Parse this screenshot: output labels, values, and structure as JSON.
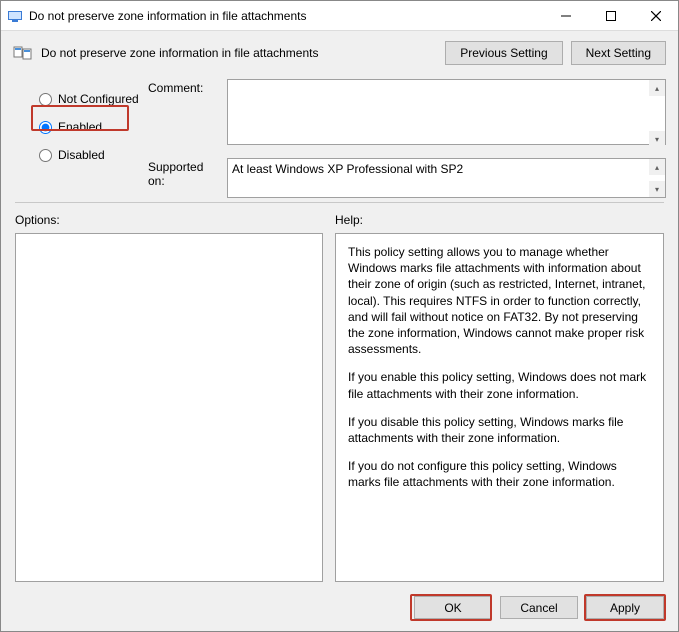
{
  "titlebar": {
    "title": "Do not preserve zone information in file attachments"
  },
  "header": {
    "setting_name": "Do not preserve zone information in file attachments",
    "previous_btn": "Previous Setting",
    "next_btn": "Next Setting"
  },
  "states": {
    "not_configured": "Not Configured",
    "enabled": "Enabled",
    "disabled": "Disabled",
    "selected": "enabled"
  },
  "labels": {
    "comment": "Comment:",
    "supported": "Supported on:",
    "options": "Options:",
    "help": "Help:"
  },
  "comment_value": "",
  "supported_value": "At least Windows XP Professional with SP2",
  "help": {
    "p1": "This policy setting allows you to manage whether Windows marks file attachments with information about their zone of origin (such as restricted, Internet, intranet, local). This requires NTFS in order to function correctly, and will fail without notice on FAT32. By not preserving the zone information, Windows cannot make proper risk assessments.",
    "p2": "If you enable this policy setting, Windows does not mark file attachments with their zone information.",
    "p3": "If you disable this policy setting, Windows marks file attachments with their zone information.",
    "p4": "If you do not configure this policy setting, Windows marks file attachments with their zone information."
  },
  "buttons": {
    "ok": "OK",
    "cancel": "Cancel",
    "apply": "Apply"
  }
}
